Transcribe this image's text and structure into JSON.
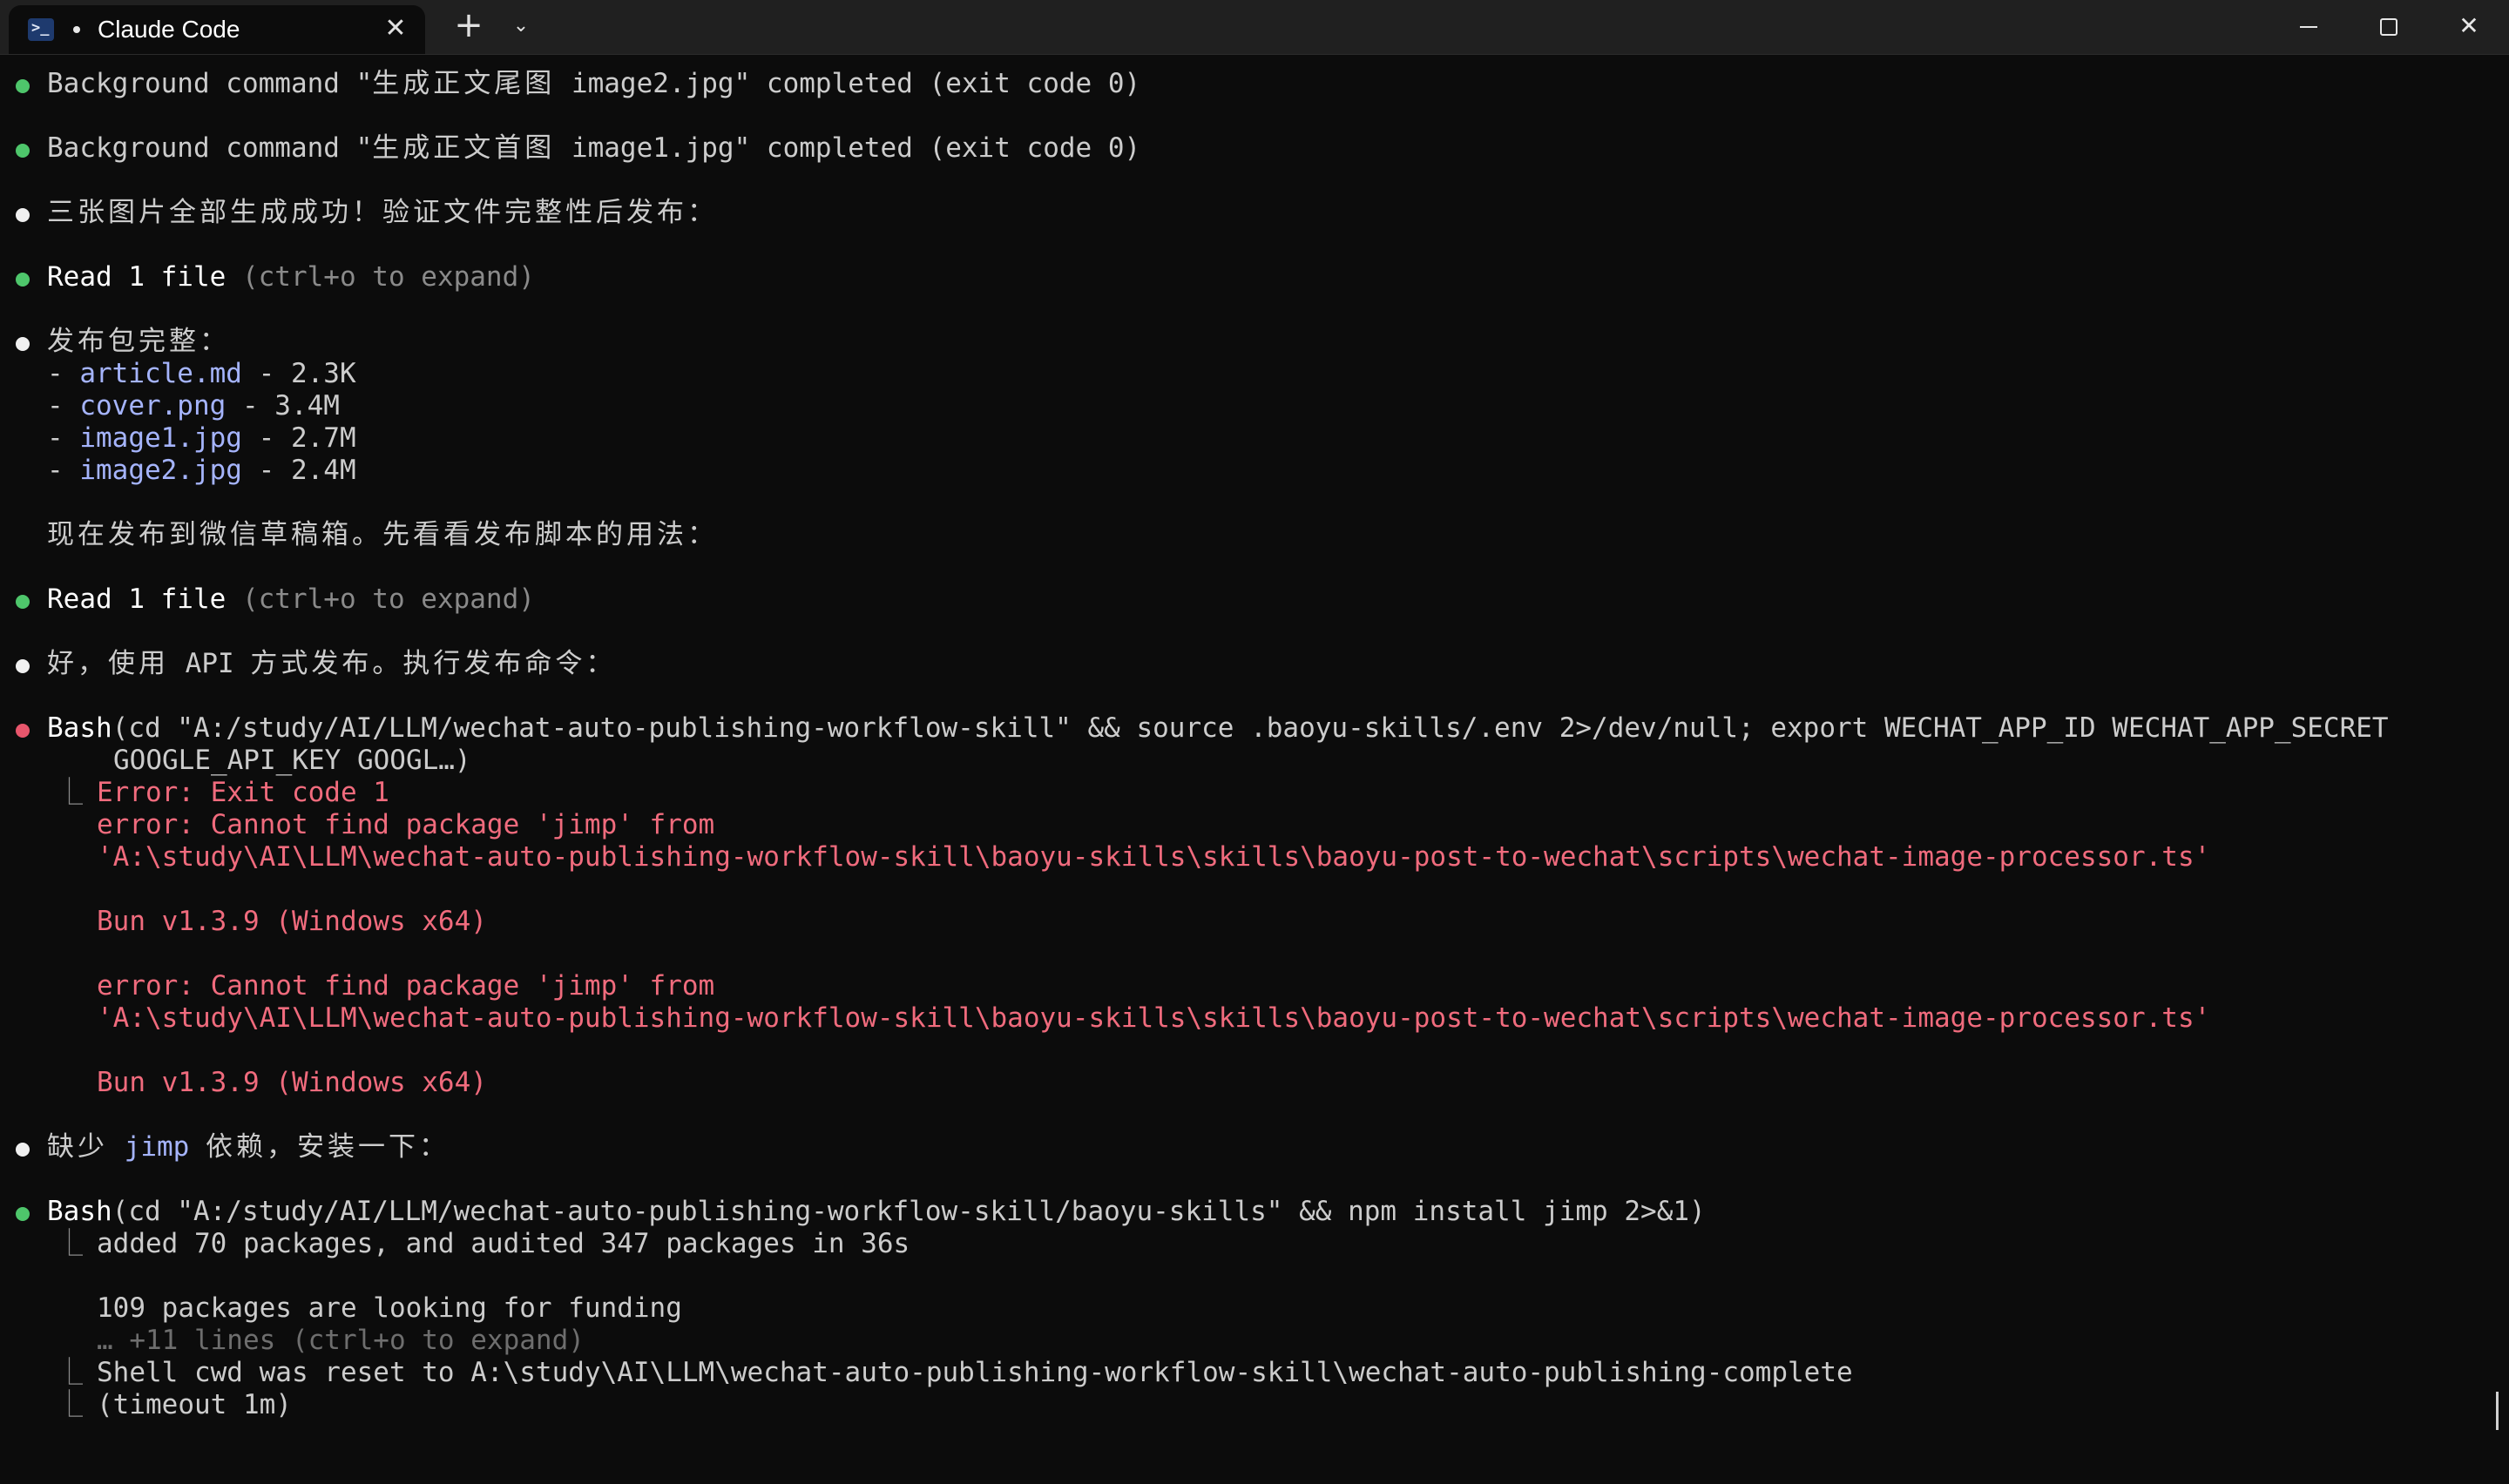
{
  "window": {
    "tab_title": "Claude Code",
    "tab_close": "✕",
    "new_tab": "+",
    "tab_dropdown": "⌄",
    "close": "✕"
  },
  "lines": {
    "l1a": "Background command \"",
    "l1b": "生成正文尾图",
    "l1c": " image2.jpg\" completed (exit code 0)",
    "l2a": "Background command \"",
    "l2b": "生成正文首图",
    "l2c": " image1.jpg\" completed (exit code 0)",
    "l3": "三张图片全部生成成功！验证文件完整性后发布：",
    "l4a": "Read 1 file",
    "l4b": " (ctrl+o to expand)",
    "l5": "发布包完整：",
    "dash": "- ",
    "f1_name": "article.md",
    "f1_size": " - 2.3K",
    "f2_name": "cover.png",
    "f2_size": " - 3.4M",
    "f3_name": "image1.jpg",
    "f3_size": " - 2.7M",
    "f4_name": "image2.jpg",
    "f4_size": " - 2.4M",
    "l6": "现在发布到微信草稿箱。先看看发布脚本的用法：",
    "l7a": "Read 1 file",
    "l7b": " (ctrl+o to expand)",
    "l8a": "好，使用",
    "l8b": " API ",
    "l8c": "方式发布。执行发布命令：",
    "l9a": "Bash",
    "l9b": "(cd \"A:/study/AI/LLM/wechat-auto-publishing-workflow-skill\" && source .baoyu-skills/.env 2>/dev/null; export WECHAT_APP_ID WECHAT_APP_SECRET",
    "l9c": "GOOGLE_API_KEY GOOGL…)",
    "tree1": "⎿",
    "e1": "Error: Exit code 1",
    "e2": "error: Cannot find package 'jimp' from",
    "e3": "'A:\\study\\AI\\LLM\\wechat-auto-publishing-workflow-skill\\baoyu-skills\\skills\\baoyu-post-to-wechat\\scripts\\wechat-image-processor.ts'",
    "e4": "Bun v1.3.9 (Windows x64)",
    "e5": "error: Cannot find package 'jimp' from",
    "e6": "'A:\\study\\AI\\LLM\\wechat-auto-publishing-workflow-skill\\baoyu-skills\\skills\\baoyu-post-to-wechat\\scripts\\wechat-image-processor.ts'",
    "e7": "Bun v1.3.9 (Windows x64)",
    "l10a": "缺少",
    "l10b": "jimp",
    "l10c": "依赖，安装一下：",
    "l11a": "Bash",
    "l11b": "(cd \"A:/study/AI/LLM/wechat-auto-publishing-workflow-skill/baoyu-skills\" && npm install jimp 2>&1)",
    "o1": "added 70 packages, and audited 347 packages in 36s",
    "o2": "109 packages are looking for funding",
    "o3": "… +11 lines (ctrl+o to expand)",
    "o4": "Shell cwd was reset to A:\\study\\AI\\LLM\\wechat-auto-publishing-workflow-skill\\wechat-auto-publishing-complete",
    "o5": "(timeout 1m)"
  }
}
